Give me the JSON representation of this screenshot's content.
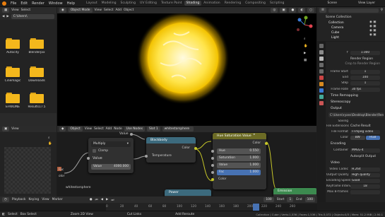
{
  "topbar": {
    "menus": [
      "File",
      "Edit",
      "Render",
      "Window",
      "Help"
    ],
    "workspaces": [
      "Layout",
      "Modeling",
      "Sculpting",
      "UV Editing",
      "Texture Paint",
      "Shading",
      "Animation",
      "Rendering",
      "Compositing",
      "Scripting"
    ],
    "active_workspace": "Shading",
    "scene": "Scene",
    "view_layer": "View Layer"
  },
  "filebrowser": {
    "header": [
      "View",
      "Select"
    ],
    "path": "C:\\Users\\",
    "folders": [
      "Autocity",
      "Blenderpix",
      "Cinemagic",
      "Downloads",
      "EFKKONE",
      "Results17.5"
    ]
  },
  "viewport": {
    "mode": "Object Mode",
    "menus": [
      "View",
      "Select",
      "Add",
      "Object"
    ]
  },
  "outliner": {
    "title": "Scene Collection",
    "items": [
      "Collection",
      "Camera",
      "Cube",
      "Light"
    ]
  },
  "properties": {
    "rows_top": [
      {
        "label": "Y",
        "value": "1.000"
      },
      {
        "label": "",
        "value": "Render Region"
      },
      {
        "label": "",
        "value": "Crop to Render Region"
      }
    ],
    "frames": [
      {
        "label": "Frame Start",
        "value": "1"
      },
      {
        "label": "End",
        "value": "100"
      },
      {
        "label": "Step",
        "value": "1"
      },
      {
        "label": "Frame Rate",
        "value": "30 fps"
      }
    ],
    "sections": [
      "Time Remapping",
      "Stereoscopy",
      "Output"
    ],
    "output_path": "C:\\Users\\ryans\\Desktop\\Blender\\Ren...",
    "checks": [
      "Saving",
      "File Extensions",
      "Cache Result"
    ],
    "file_format_label": "File Format",
    "file_format": "FFmpeg video",
    "color_label": "Color",
    "color_opts": [
      "BW",
      "RGB"
    ],
    "encoding": "Encoding",
    "container_label": "Container",
    "container": "MPEG-4",
    "autosplit": "Autosplit Output",
    "video": "Video",
    "video_rows": [
      {
        "label": "Video Codec",
        "value": "H.264"
      },
      {
        "label": "Output Quality",
        "value": "High quality"
      },
      {
        "label": "Encoding Speed",
        "value": "Good"
      },
      {
        "label": "Keyframe Interval",
        "value": "18"
      },
      {
        "label": "Max B-frames",
        "value": ""
      }
    ]
  },
  "node_editor": {
    "header": [
      "Object",
      "View",
      "Select",
      "Add",
      "Node",
      "Use Nodes",
      "Slot 1",
      "whitestarsphere"
    ],
    "value_node_label": "Value",
    "math": {
      "op": "Multiply",
      "clamp": "Clamp",
      "value_label": "Value",
      "value": "4000.000",
      "in_label": "Value"
    },
    "blackbody": {
      "title": "Blackbody",
      "color": "Color",
      "temp": "Temperature"
    },
    "hsv": {
      "title": "Hue Saturation Value",
      "color_out": "Color",
      "rows": [
        {
          "label": "Hue",
          "value": "0.550"
        },
        {
          "label": "Saturation",
          "value": "1.000"
        },
        {
          "label": "Value",
          "value": "1.000"
        },
        {
          "label": "Fac",
          "value": "1.000"
        }
      ],
      "color_in": "Color"
    },
    "power": "Power",
    "emission": "Emission",
    "material": "whitestarsphere",
    "left_labels": [
      "Fac",
      "olor"
    ]
  },
  "timeline": {
    "items": [
      "Playback",
      "Keying",
      "View",
      "Marker"
    ],
    "start": "Start",
    "start_val": "1",
    "end": "End",
    "end_val": "100",
    "frame": "100",
    "ticks": [
      "0",
      "20",
      "40",
      "60",
      "80",
      "100",
      "120",
      "140",
      "160",
      "180",
      "200",
      "220",
      "240",
      "260"
    ]
  },
  "statusbar": {
    "left": [
      "Select",
      "Box Select"
    ],
    "mid": [
      "Zoom 2D View",
      "Cut Links"
    ],
    "center": "Add Reroute",
    "right": "Collection | Cube | Verts:1,536 | Faces:1,536 | Tris:3,072 | Objects:0/3 | Mem: 51.2 MiB | 2.90.1"
  }
}
